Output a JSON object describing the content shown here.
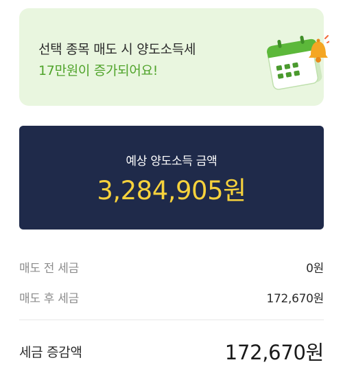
{
  "notice": {
    "line1": "선택 종목 매도 시 양도소득세",
    "line2": "17만원이 증가되어요!",
    "icon": "calendar-bell-icon",
    "background_color": "#e9f6df",
    "highlight_color": "#4fa32a"
  },
  "estimate": {
    "label": "예상 양도소득 금액",
    "value": "3,284,905원",
    "background_color": "#1f2a4a",
    "value_color": "#f7d23c"
  },
  "breakdown": {
    "rows": [
      {
        "label": "매도 전 세금",
        "value": "0원"
      },
      {
        "label": "매도 후 세금",
        "value": "172,670원"
      }
    ]
  },
  "total": {
    "label": "세금 증감액",
    "value": "172,670원"
  }
}
